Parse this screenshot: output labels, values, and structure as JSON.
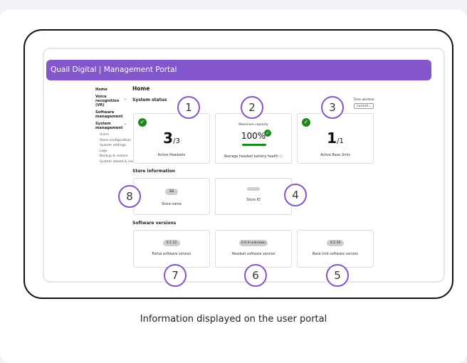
{
  "header": {
    "title": "Quail Digital | Management Portal"
  },
  "sidebar": {
    "items": [
      {
        "label": "Home"
      },
      {
        "label": "Voice recognition (VR)"
      },
      {
        "label": "Software management"
      },
      {
        "label": "System management"
      }
    ],
    "sub_items": [
      "Users",
      "Store configuration",
      "System settings",
      "Logs",
      "Backup & restore",
      "System reboot & reset"
    ]
  },
  "main": {
    "page_title": "Home",
    "system_status_title": "System status",
    "time_window": {
      "label": "Time window",
      "value": "current"
    },
    "status_tiles": [
      {
        "value": "3",
        "total": "/3",
        "label": "Active Headsets"
      },
      {
        "caption": "Maximum capacity",
        "value": "100%",
        "label": "Average headset battery health ⓘ",
        "progress": 1.0
      },
      {
        "value": "1",
        "total": "/1",
        "label": "Active Base Units"
      }
    ],
    "store_info_title": "Store information",
    "store_tiles": [
      {
        "value": "SD",
        "label": "Store name"
      },
      {
        "value": "",
        "label": "Store ID"
      }
    ],
    "software_title": "Software versions",
    "software_tiles": [
      {
        "value": "0.1.22",
        "label": "Portal software version"
      },
      {
        "value": "0.0.0-unknown",
        "label": "Headset software version"
      },
      {
        "value": "0.2.19",
        "label": "Base Unit software version"
      }
    ]
  },
  "callouts": [
    "1",
    "2",
    "3",
    "4",
    "5",
    "6",
    "7",
    "8"
  ],
  "caption": "Information displayed on the user portal",
  "colors": {
    "accent": "#8456cb",
    "ok": "#1b8a1b"
  }
}
